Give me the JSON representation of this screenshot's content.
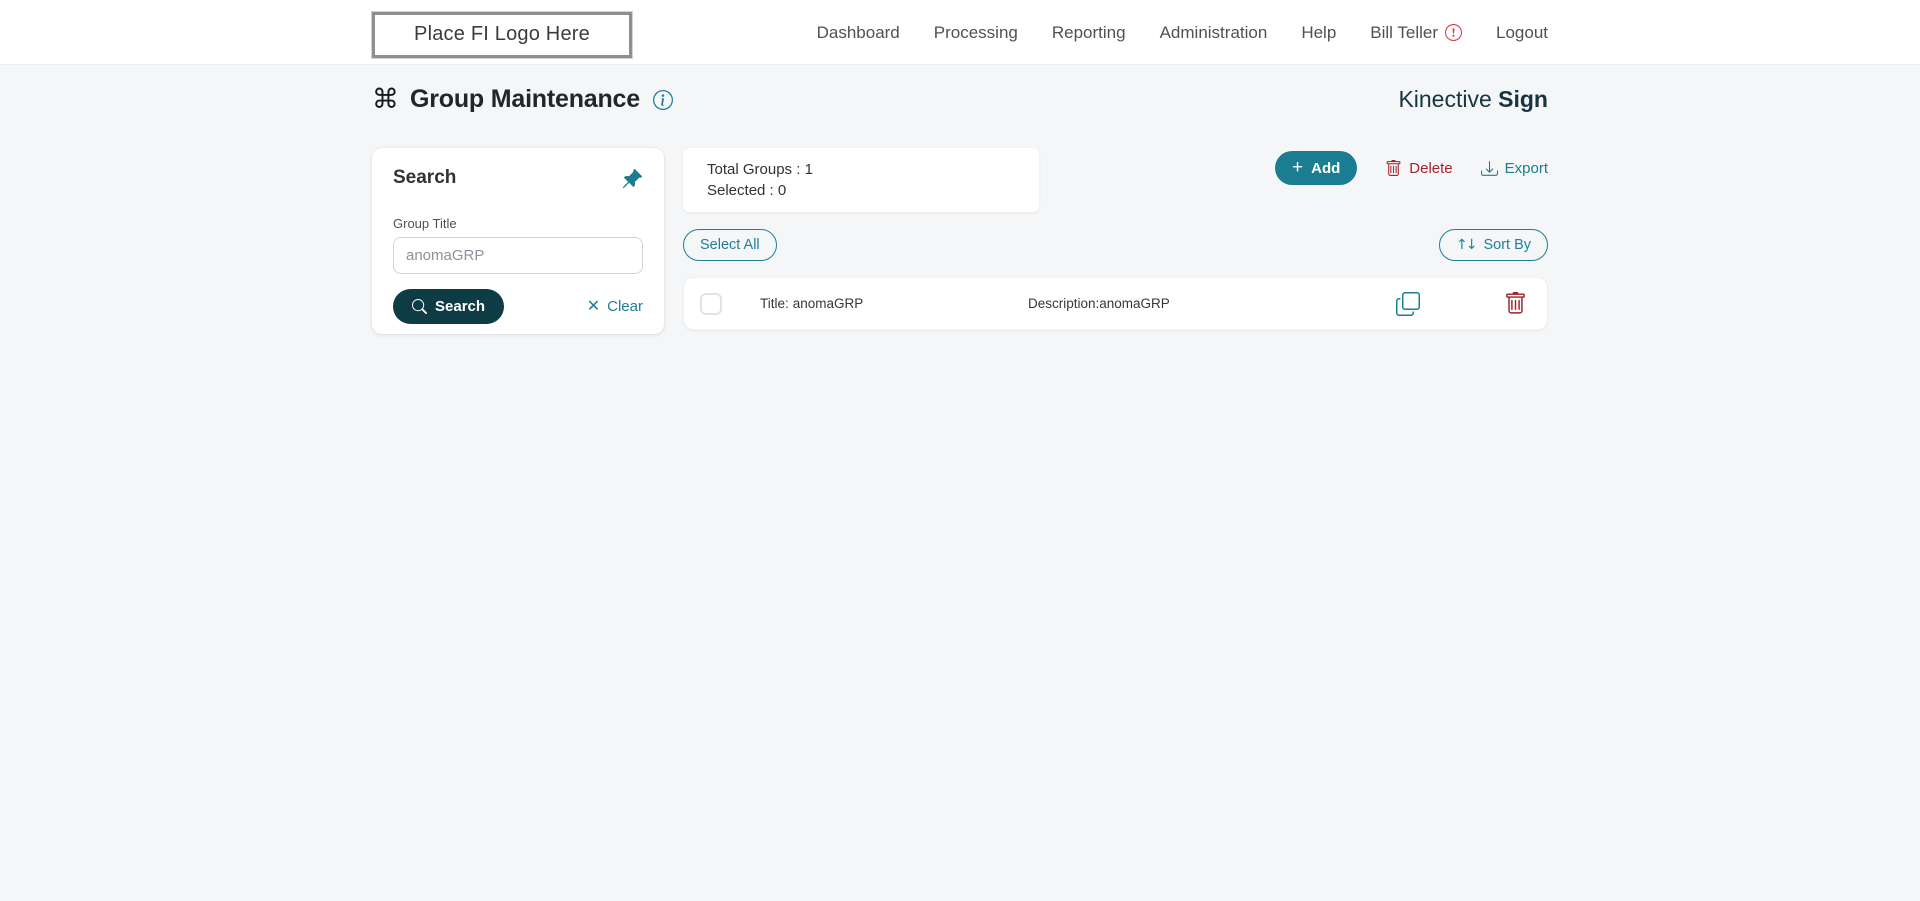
{
  "header": {
    "logo_text": "Place FI Logo Here",
    "nav": [
      {
        "label": "Dashboard"
      },
      {
        "label": "Processing"
      },
      {
        "label": "Reporting"
      },
      {
        "label": "Administration"
      },
      {
        "label": "Help"
      },
      {
        "label": "Bill Teller"
      },
      {
        "label": "Logout"
      }
    ]
  },
  "page": {
    "title": "Group Maintenance",
    "brand_name": "Kinective",
    "brand_product": "Sign"
  },
  "search_panel": {
    "title": "Search",
    "field_label": "Group Title",
    "field_value": "anomaGRP",
    "search_button_label": "Search",
    "clear_button_label": "Clear"
  },
  "summary": {
    "total_groups_label": "Total Groups :",
    "total_groups_value": "1",
    "selected_label": "Selected :",
    "selected_value": "0"
  },
  "toolbar": {
    "add_label": "Add",
    "delete_label": "Delete",
    "export_label": "Export"
  },
  "list_controls": {
    "select_all_label": "Select All",
    "sort_by_label": "Sort By"
  },
  "groups": [
    {
      "title_label": "Title:",
      "title_value": "anomaGRP",
      "description_label": "Description:",
      "description_value": "anomaGRP",
      "selected": false
    }
  ],
  "colors": {
    "teal": "#1b7d92",
    "link_teal": "#1f7f98",
    "dark_teal_button": "#0d3c44",
    "brand_text": "#16353e",
    "delete_red": "#a3242e",
    "alert_red": "#dc3545",
    "page_background": "#f5f6f8"
  }
}
